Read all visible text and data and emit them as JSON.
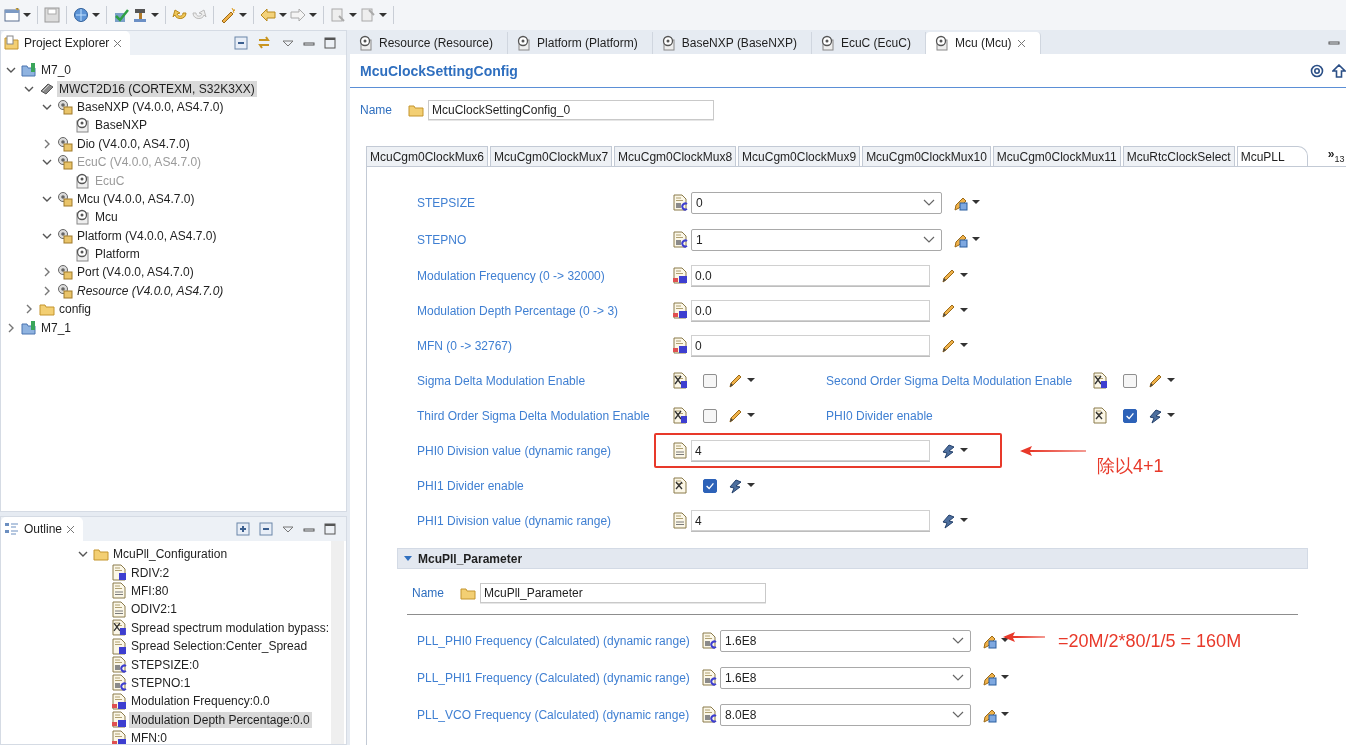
{
  "project_explorer": {
    "title": "Project Explorer",
    "tree": [
      {
        "label": "M7_0",
        "kind": "project",
        "expanded": true,
        "selected": false,
        "disabled": false,
        "italic": false,
        "children": [
          {
            "label": "MWCT2D16 (CORTEXM, S32K3XX)",
            "kind": "chip",
            "expanded": true,
            "selected": true,
            "disabled": false,
            "italic": false,
            "children": [
              {
                "label": "BaseNXP (V4.0.0, AS4.7.0)",
                "kind": "module",
                "expanded": true,
                "selected": false,
                "disabled": false,
                "italic": false,
                "children": [
                  {
                    "label": "BaseNXP",
                    "kind": "config",
                    "selected": false,
                    "disabled": false,
                    "italic": false
                  }
                ]
              },
              {
                "label": "Dio (V4.0.0, AS4.7.0)",
                "kind": "module",
                "expanded": false,
                "selected": false,
                "disabled": false,
                "italic": false
              },
              {
                "label": "EcuC (V4.0.0, AS4.7.0)",
                "kind": "module",
                "expanded": true,
                "selected": false,
                "disabled": true,
                "italic": false,
                "children": [
                  {
                    "label": "EcuC",
                    "kind": "config",
                    "selected": false,
                    "disabled": true,
                    "italic": false
                  }
                ]
              },
              {
                "label": "Mcu (V4.0.0, AS4.7.0)",
                "kind": "module",
                "expanded": true,
                "selected": false,
                "disabled": false,
                "italic": false,
                "children": [
                  {
                    "label": "Mcu",
                    "kind": "config",
                    "selected": false,
                    "disabled": false,
                    "italic": false
                  }
                ]
              },
              {
                "label": "Platform (V4.0.0, AS4.7.0)",
                "kind": "module",
                "expanded": true,
                "selected": false,
                "disabled": false,
                "italic": false,
                "children": [
                  {
                    "label": "Platform",
                    "kind": "config",
                    "selected": false,
                    "disabled": false,
                    "italic": false
                  }
                ]
              },
              {
                "label": "Port (V4.0.0, AS4.7.0)",
                "kind": "module",
                "expanded": false,
                "selected": false,
                "disabled": false,
                "italic": false
              },
              {
                "label": "Resource (V4.0.0, AS4.7.0)",
                "kind": "module",
                "expanded": false,
                "selected": false,
                "disabled": false,
                "italic": true
              }
            ]
          },
          {
            "label": "config",
            "kind": "folder",
            "expanded": false,
            "selected": false,
            "disabled": false,
            "italic": false
          }
        ]
      },
      {
        "label": "M7_1",
        "kind": "project",
        "expanded": false,
        "selected": false,
        "disabled": false,
        "italic": false
      }
    ]
  },
  "outline": {
    "title": "Outline",
    "tree": [
      {
        "label": "McuPll_Configuration",
        "kind": "folder",
        "expanded": true,
        "selected": false,
        "children": [
          {
            "label": "RDIV:2",
            "kind": "enum",
            "selected": false
          },
          {
            "label": "MFI:80",
            "kind": "integer",
            "selected": false
          },
          {
            "label": "ODIV2:1",
            "kind": "integer",
            "selected": false
          },
          {
            "label": "Spread spectrum modulation bypass:",
            "kind": "boolean",
            "selected": false
          },
          {
            "label": "Spread Selection:Center_Spread",
            "kind": "enum",
            "selected": false
          },
          {
            "label": "STEPSIZE:0",
            "kind": "calc",
            "selected": false
          },
          {
            "label": "STEPNO:1",
            "kind": "calc",
            "selected": false
          },
          {
            "label": "Modulation Frequency:0.0",
            "kind": "float",
            "selected": false
          },
          {
            "label": "Modulation Depth Percentage:0.0",
            "kind": "float",
            "selected": true
          },
          {
            "label": "MFN:0",
            "kind": "float",
            "selected": false
          }
        ]
      }
    ]
  },
  "editor": {
    "tabs": [
      {
        "label": "Resource (Resource)",
        "selected": false
      },
      {
        "label": "Platform (Platform)",
        "selected": false
      },
      {
        "label": "BaseNXP (BaseNXP)",
        "selected": false
      },
      {
        "label": "EcuC (EcuC)",
        "selected": false
      },
      {
        "label": "Mcu (Mcu)",
        "selected": true
      }
    ],
    "title": "McuClockSettingConfig",
    "name": {
      "label": "Name",
      "value": "McuClockSettingConfig_0"
    },
    "sub_tabs": [
      {
        "label": "McuCgm0ClockMux6",
        "selected": false
      },
      {
        "label": "McuCgm0ClockMux7",
        "selected": false
      },
      {
        "label": "McuCgm0ClockMux8",
        "selected": false
      },
      {
        "label": "McuCgm0ClockMux9",
        "selected": false
      },
      {
        "label": "McuCgm0ClockMux10",
        "selected": false
      },
      {
        "label": "McuCgm0ClockMux11",
        "selected": false
      },
      {
        "label": "McuRtcClockSelect",
        "selected": false
      },
      {
        "label": "McuPLL",
        "selected": true
      }
    ],
    "more_tabs": {
      "glyph": "»",
      "count": "13"
    },
    "rows": [
      {
        "items": [
          {
            "label": "STEPSIZE",
            "kind": "combo",
            "icon": {
              "kind": "calc"
            },
            "value": "0",
            "tool": {
              "kind": "calc"
            }
          }
        ]
      },
      {
        "items": [
          {
            "label": "STEPNO",
            "kind": "combo",
            "icon": {
              "kind": "calc"
            },
            "value": "1",
            "tool": {
              "kind": "calc"
            }
          }
        ]
      },
      {
        "items": [
          {
            "label": "Modulation Frequency (0 -> 32000)",
            "kind": "text",
            "icon": {
              "kind": "float"
            },
            "value": "0.0",
            "tool": {
              "kind": "pencil"
            }
          }
        ]
      },
      {
        "items": [
          {
            "label": "Modulation Depth Percentage (0 -> 3)",
            "kind": "text",
            "icon": {
              "kind": "float"
            },
            "value": "0.0",
            "tool": {
              "kind": "pencil"
            }
          }
        ]
      },
      {
        "items": [
          {
            "label": "MFN (0 -> 32767)",
            "kind": "text",
            "icon": {
              "kind": "float"
            },
            "value": "0",
            "tool": {
              "kind": "pencil"
            }
          }
        ]
      },
      {
        "items": [
          {
            "label": "Sigma Delta Modulation Enable",
            "kind": "check",
            "icon": {
              "kind": "boolean"
            },
            "checked": false,
            "tool": {
              "kind": "pencil"
            }
          },
          {
            "label": "Second Order Sigma Delta Modulation Enable",
            "kind": "check",
            "icon": {
              "kind": "boolean"
            },
            "checked": false,
            "tool": {
              "kind": "pencil"
            }
          }
        ]
      },
      {
        "items": [
          {
            "label": "Third Order Sigma Delta Modulation Enable",
            "kind": "check",
            "icon": {
              "kind": "boolean"
            },
            "checked": false,
            "tool": {
              "kind": "pencil"
            }
          },
          {
            "label": "PHI0 Divider enable",
            "kind": "check",
            "icon": {
              "kind": "flag"
            },
            "checked": true,
            "tool": {
              "kind": "link"
            }
          }
        ]
      },
      {
        "items": [
          {
            "label": "PHI0 Division value (dynamic range)",
            "kind": "text",
            "icon": {
              "kind": "integer"
            },
            "value": "4",
            "tool": {
              "kind": "link"
            },
            "callout": {
              "frame": true,
              "text": "除以4+1"
            }
          }
        ]
      },
      {
        "items": [
          {
            "label": "PHI1 Divider enable",
            "kind": "check",
            "icon": {
              "kind": "flag"
            },
            "checked": true,
            "tool": {
              "kind": "link"
            }
          }
        ]
      },
      {
        "items": [
          {
            "label": "PHI1 Division value (dynamic range)",
            "kind": "text",
            "icon": {
              "kind": "integer"
            },
            "value": "4",
            "tool": {
              "kind": "link"
            }
          }
        ]
      }
    ],
    "section": {
      "title": "McuPll_Parameter",
      "expanded": true,
      "name": {
        "label": "Name",
        "value": "McuPll_Parameter"
      },
      "rows": [
        {
          "items": [
            {
              "label": "PLL_PHI0 Frequency (Calculated) (dynamic range)",
              "kind": "combo",
              "icon": {
                "kind": "calc"
              },
              "value": "1.6E8",
              "tool": {
                "kind": "calc"
              },
              "callout": {
                "frame": false,
                "text": "=20M/2*80/1/5 = 160M"
              }
            }
          ]
        },
        {
          "items": [
            {
              "label": "PLL_PHI1 Frequency (Calculated) (dynamic range)",
              "kind": "combo",
              "icon": {
                "kind": "calc"
              },
              "value": "1.6E8",
              "tool": {
                "kind": "calc"
              }
            }
          ]
        },
        {
          "items": [
            {
              "label": "PLL_VCO Frequency (Calculated) (dynamic range)",
              "kind": "combo",
              "icon": {
                "kind": "calc"
              },
              "value": "8.0E8",
              "tool": {
                "kind": "calc"
              }
            }
          ]
        }
      ]
    }
  }
}
